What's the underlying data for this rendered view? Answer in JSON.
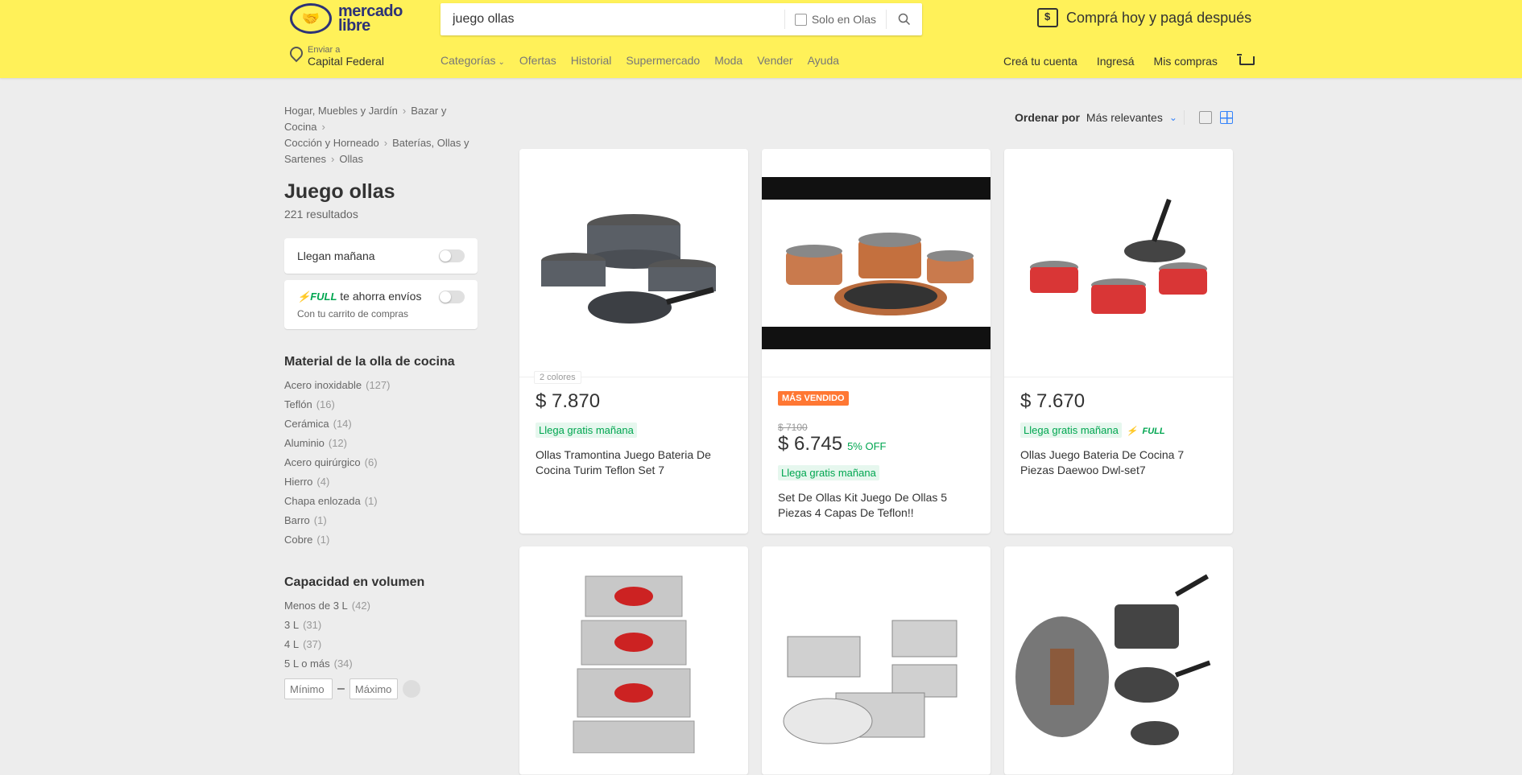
{
  "header": {
    "logo_text_line1": "mercado",
    "logo_text_line2": "libre",
    "search_value": "juego ollas",
    "search_only_store_label": "Solo en Olas",
    "promo_text": "Comprá hoy y pagá después",
    "location_small": "Enviar a",
    "location_city": "Capital Federal",
    "nav": [
      "Categorías",
      "Ofertas",
      "Historial",
      "Supermercado",
      "Moda",
      "Vender",
      "Ayuda"
    ],
    "user_nav": [
      "Creá tu cuenta",
      "Ingresá",
      "Mis compras"
    ]
  },
  "sidebar": {
    "breadcrumb": [
      "Hogar, Muebles y Jardín",
      "Bazar y Cocina",
      "Cocción y Horneado",
      "Baterías, Ollas y Sartenes",
      "Ollas"
    ],
    "title": "Juego ollas",
    "results": "221 resultados",
    "toggle_tomorrow": "Llegan mañana",
    "full_brand": "FULL",
    "full_text": "te ahorra envíos",
    "full_sub": "Con tu carrito de compras",
    "material_title": "Material de la olla de cocina",
    "material_items": [
      {
        "label": "Acero inoxidable",
        "count": "(127)"
      },
      {
        "label": "Teflón",
        "count": "(16)"
      },
      {
        "label": "Cerámica",
        "count": "(14)"
      },
      {
        "label": "Aluminio",
        "count": "(12)"
      },
      {
        "label": "Acero quirúrgico",
        "count": "(6)"
      },
      {
        "label": "Hierro",
        "count": "(4)"
      },
      {
        "label": "Chapa enlozada",
        "count": "(1)"
      },
      {
        "label": "Barro",
        "count": "(1)"
      },
      {
        "label": "Cobre",
        "count": "(1)"
      }
    ],
    "capacity_title": "Capacidad en volumen",
    "capacity_items": [
      {
        "label": "Menos de 3 L",
        "count": "(42)"
      },
      {
        "label": "3 L",
        "count": "(31)"
      },
      {
        "label": "4 L",
        "count": "(37)"
      },
      {
        "label": "5 L o más",
        "count": "(34)"
      }
    ],
    "range_min_placeholder": "Mínimo",
    "range_max_placeholder": "Máximo"
  },
  "sort": {
    "label": "Ordenar por",
    "value": "Más relevantes"
  },
  "products": [
    {
      "colors": "2 colores",
      "price": "$ 7.870",
      "free": "Llega gratis mañana",
      "title": "Ollas Tramontina Juego Bateria De Cocina Turim Teflon Set 7"
    },
    {
      "badge": "MÁS VENDIDO",
      "old_price": "$ 7100",
      "price": "$ 6.745",
      "discount": "5% OFF",
      "free": "Llega gratis mañana",
      "title": "Set De Ollas Kit Juego De Ollas 5 Piezas 4 Capas De Teflon!!"
    },
    {
      "price": "$ 7.670",
      "free": "Llega gratis mañana",
      "full": "FULL",
      "title": "Ollas Juego Bateria De Cocina 7 Piezas Daewoo Dwl-set7"
    }
  ],
  "colors": {
    "header_yellow": "#fff159",
    "accent_blue": "#3483fa",
    "green": "#00a650",
    "badge_orange": "#ff7733"
  }
}
